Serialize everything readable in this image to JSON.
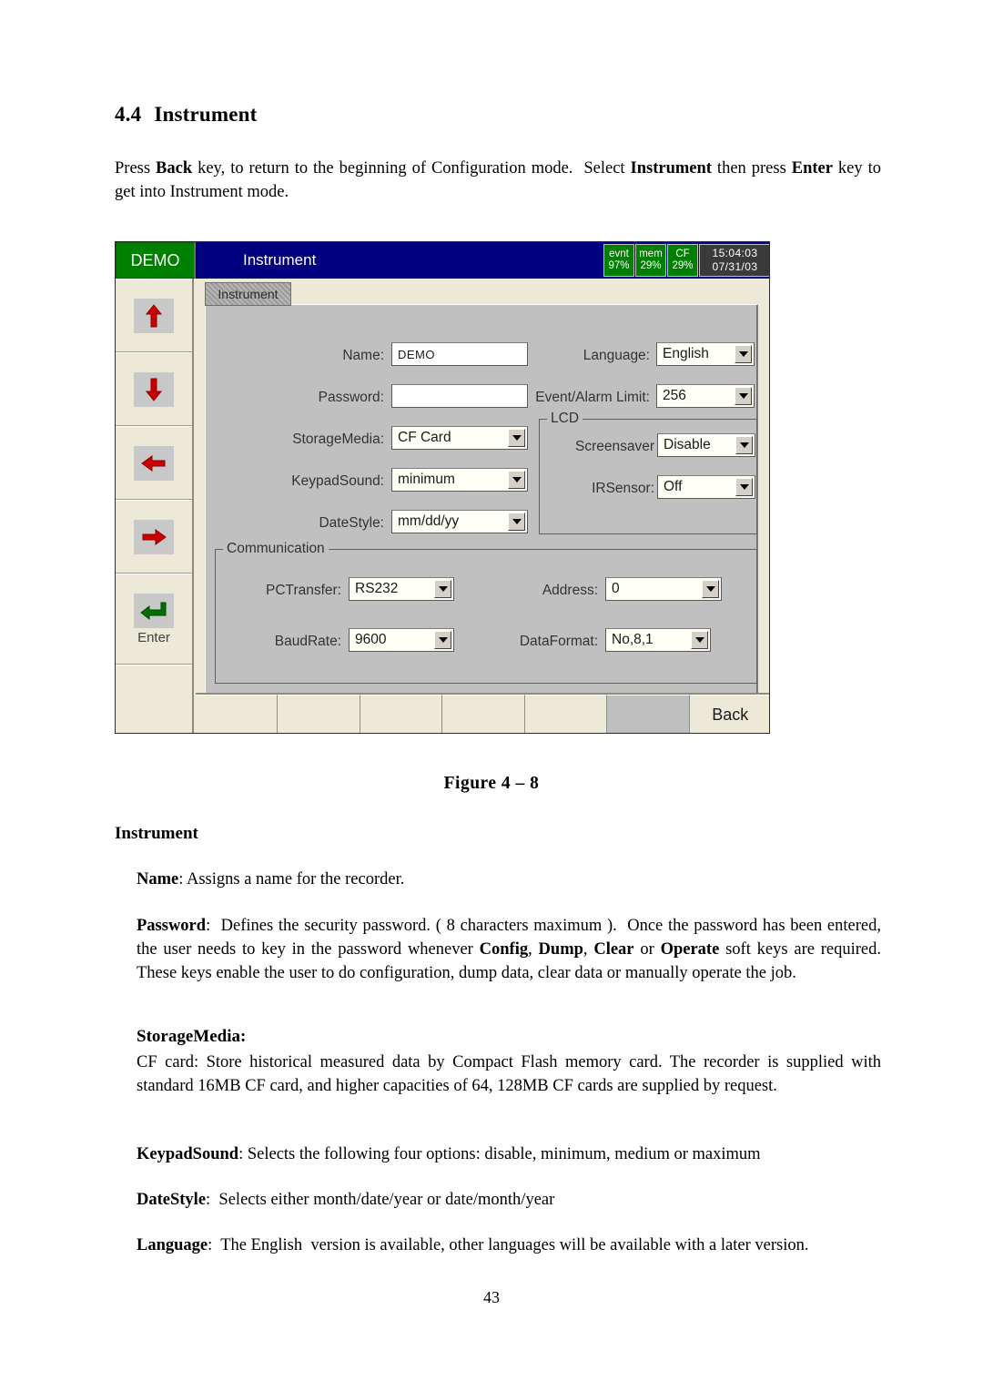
{
  "document": {
    "heading_number": "4.4",
    "heading_title": "Instrument",
    "intro_paragraph_html": "Press <b>Back</b> key, to return to the beginning of Configuration mode.&nbsp; Select <b>Instrument</b> then press <b>Enter</b> key to get into Instrument mode.",
    "figure_caption": "Figure 4 –  8",
    "section_subhead": "Instrument",
    "name_paragraph_html": "<b>Name</b>: Assigns a name for the recorder.",
    "password_paragraph_html": "<b>Password</b>:&nbsp; Defines the security password. ( 8 characters maximum ).&nbsp; Once the password has been entered, the user needs to key in the password whenever <b>Config</b>, <b>Dump</b>, <b>Clear</b> or <b>Operate</b> soft keys are required. These keys enable the user to do configuration, dump data, clear data or manually operate the job.",
    "storagemedia_subhead_html": "<b>StorageMedia</b>:",
    "storagemedia_paragraph_html": "CF card: Store historical measured data by Compact Flash memory card. The recorder is supplied with standard 16MB CF card, and higher capacities of 64, 128MB CF cards are supplied by request.",
    "keypadsound_paragraph_html": "<b>KeypadSound</b>: Selects the following four options: disable, minimum, medium or maximum",
    "datestyle_paragraph_html": "<b>DateStyle</b>:&nbsp; Selects either month/date/year or date/month/year",
    "language_paragraph_html": "<b>Language</b>:&nbsp; The English&nbsp; version is available, other languages will be available with a later version.",
    "page_number": "43"
  },
  "device": {
    "topbar": {
      "demo_badge": "DEMO",
      "title": "Instrument",
      "status": [
        {
          "name": "evnt",
          "value": "97%"
        },
        {
          "name": "mem",
          "value": "29%"
        },
        {
          "name": "CF",
          "value": "29%"
        }
      ],
      "time": "15:04:03",
      "date": "07/31/03"
    },
    "keypad": [
      {
        "name": "up-arrow-key",
        "icon": "arrow-up-icon",
        "label": ""
      },
      {
        "name": "down-arrow-key",
        "icon": "arrow-down-icon",
        "label": ""
      },
      {
        "name": "left-arrow-key",
        "icon": "arrow-left-icon",
        "label": ""
      },
      {
        "name": "right-arrow-key",
        "icon": "arrow-right-icon",
        "label": ""
      },
      {
        "name": "enter-key",
        "icon": "enter-arrow-icon",
        "label": "Enter"
      }
    ],
    "tab": "Instrument",
    "form": {
      "name": {
        "label": "Name:",
        "value": "DEMO",
        "type": "text"
      },
      "password": {
        "label": "Password:",
        "value": "",
        "type": "text"
      },
      "storagemedia": {
        "label": "StorageMedia:",
        "value": "CF Card",
        "type": "select"
      },
      "keypadsound": {
        "label": "KeypadSound:",
        "value": "minimum",
        "type": "select"
      },
      "datestyle": {
        "label": "DateStyle:",
        "value": "mm/dd/yy",
        "type": "select"
      },
      "language": {
        "label": "Language:",
        "value": "English",
        "type": "select"
      },
      "eventalarmlimit": {
        "label": "Event/Alarm Limit:",
        "value": "256",
        "type": "select"
      }
    },
    "lcd_group": {
      "title": "LCD",
      "screensaver": {
        "label": "Screensaver",
        "value": "Disable",
        "type": "select"
      },
      "irsensor": {
        "label": "IRSensor:",
        "value": "Off",
        "type": "select"
      }
    },
    "communication_group": {
      "title": "Communication",
      "pctransfer": {
        "label": "PCTransfer:",
        "value": "RS232",
        "type": "select"
      },
      "address": {
        "label": "Address:",
        "value": "0",
        "type": "select"
      },
      "baudrate": {
        "label": "BaudRate:",
        "value": "9600",
        "type": "select"
      },
      "dataformat": {
        "label": "DataFormat:",
        "value": "No,8,1",
        "type": "select"
      }
    },
    "softkeys": [
      "",
      "",
      "",
      "",
      "",
      "",
      "Back"
    ],
    "colors": {
      "badge_green": "#008000",
      "titlebar_blue": "#000080",
      "panel_gray": "#c0c0c0",
      "chrome_beige": "#ece9d8",
      "clock_dark": "#3a3a3a",
      "arrow_red": "#cc0000",
      "enter_green": "#007000"
    }
  }
}
